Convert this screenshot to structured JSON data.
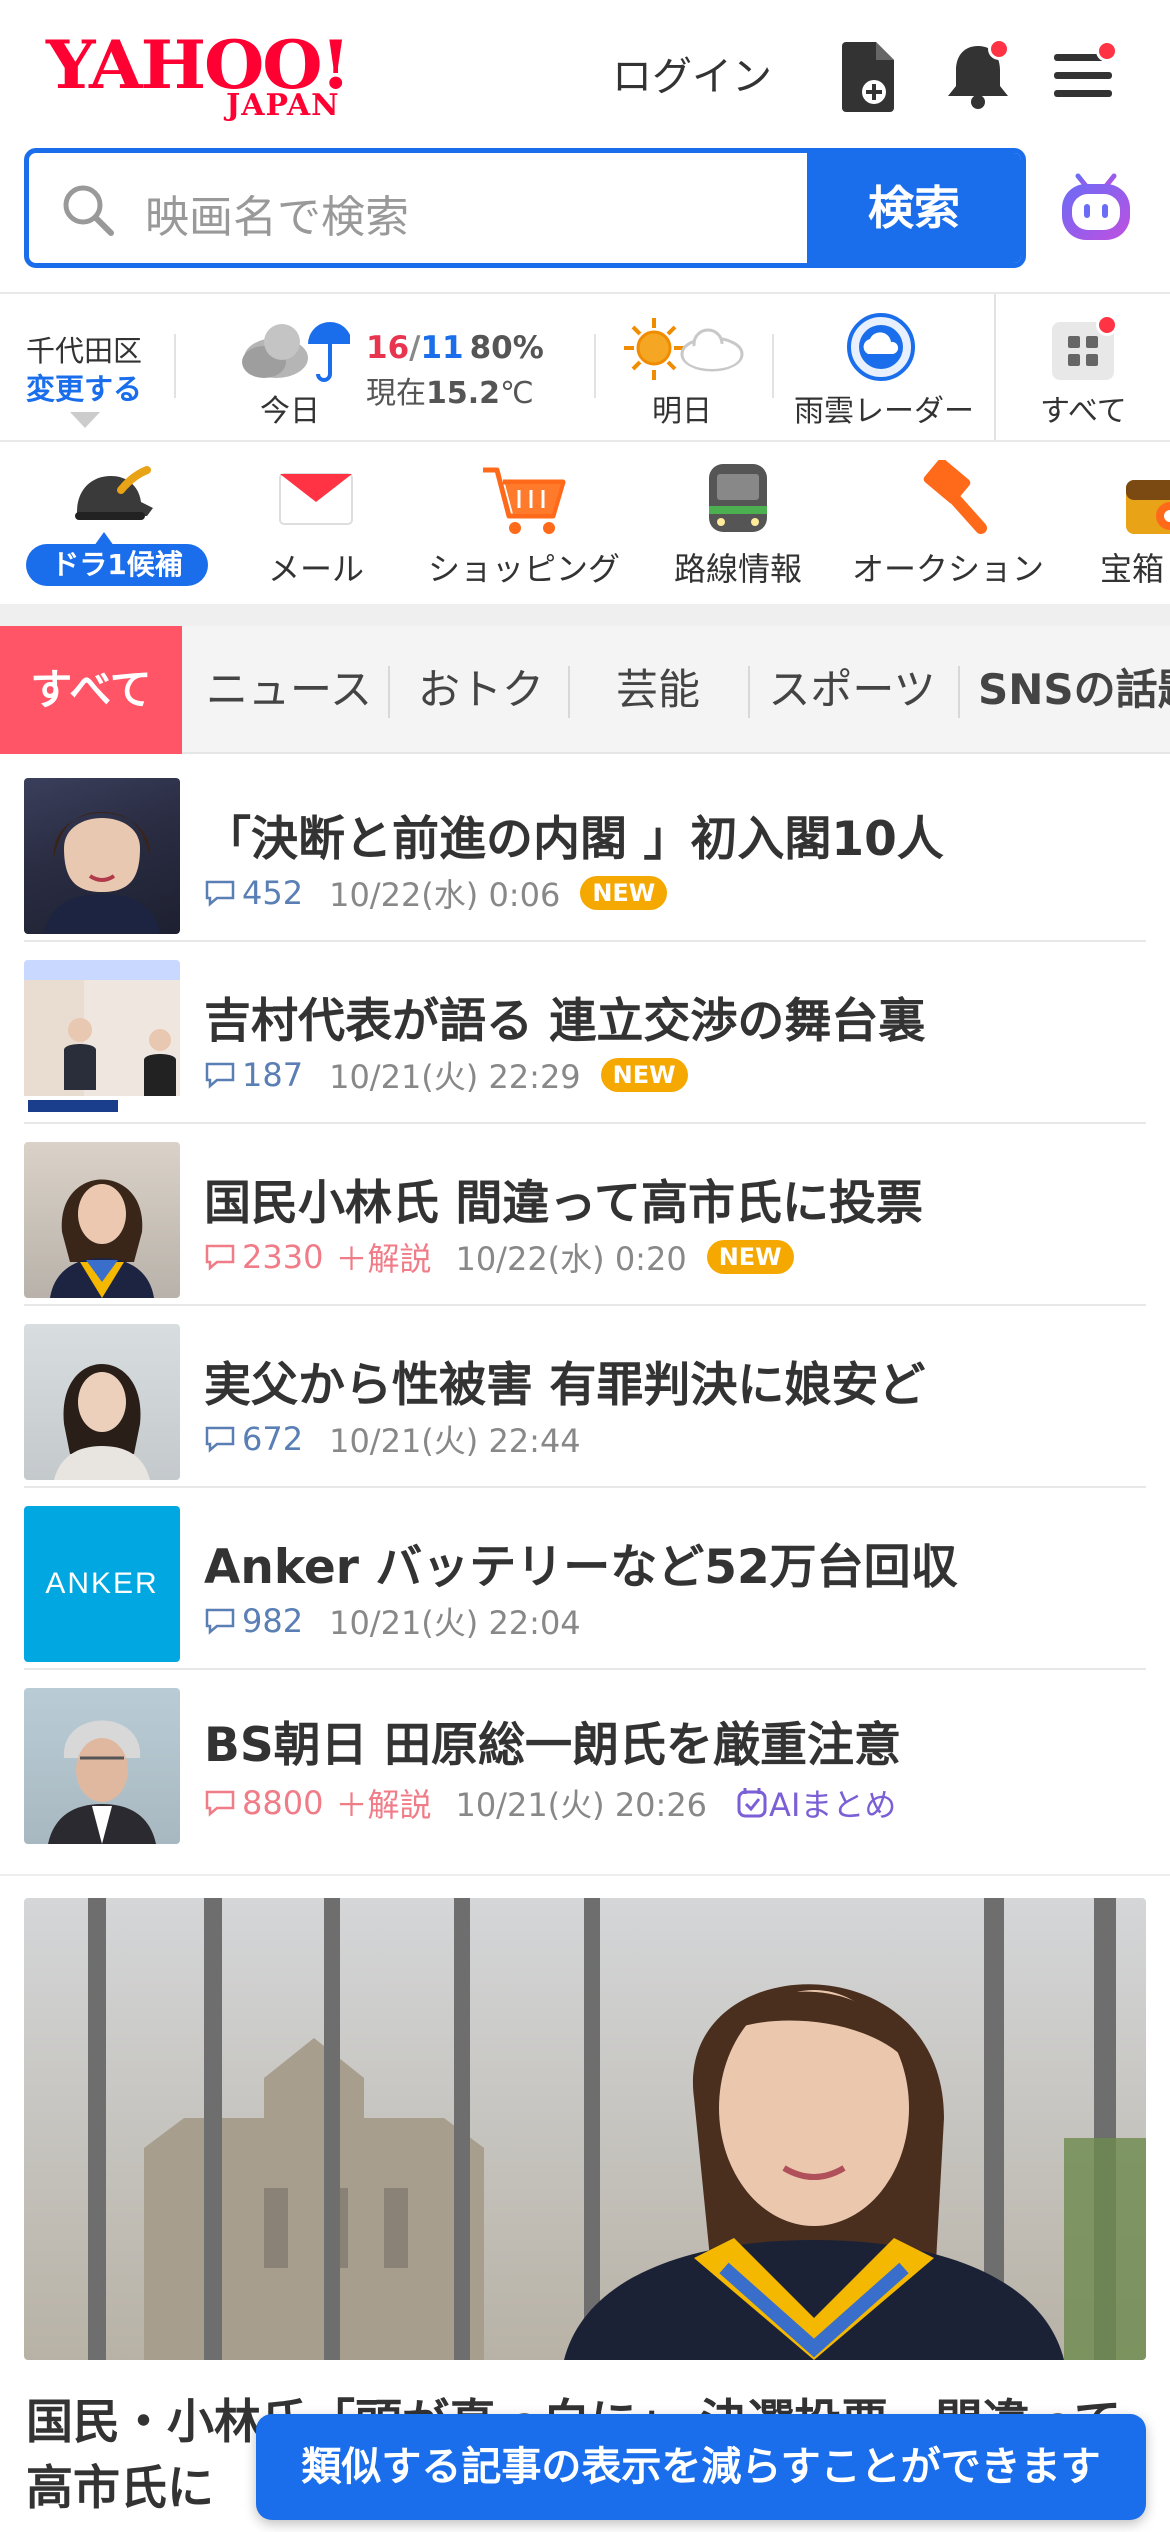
{
  "header": {
    "logo_text": "YAHOO!",
    "logo_sub": "JAPAN",
    "login_label": "ログイン",
    "icons": [
      "add-document-icon",
      "bell-icon",
      "menu-icon"
    ]
  },
  "search": {
    "placeholder": "映画名で検索",
    "button_label": "検索"
  },
  "weather": {
    "location": "千代田区",
    "change_label": "変更する",
    "today_label": "今日",
    "high": "16",
    "slash": "/",
    "low": "11",
    "rain_chance": "80%",
    "current_prefix": "現在",
    "current_temp": "15.2",
    "current_unit": "℃",
    "tomorrow_label": "明日",
    "radar_label": "雨雲レーダー",
    "all_label": "すべて",
    "colors": {
      "high": "#e8344e",
      "low": "#1a6eeb"
    }
  },
  "services": [
    {
      "label": "ドラ1候補",
      "icon": "baseball-helmet-icon"
    },
    {
      "label": "メール",
      "icon": "mail-icon"
    },
    {
      "label": "ショッピング",
      "icon": "shopping-cart-icon"
    },
    {
      "label": "路線情報",
      "icon": "train-icon"
    },
    {
      "label": "オークション",
      "icon": "auction-hammer-icon"
    },
    {
      "label": "宝箱",
      "icon": "treasure-chest-icon"
    }
  ],
  "tabs": [
    "すべて",
    "ニュース",
    "おトク",
    "芸能",
    "スポーツ",
    "SNSの話題"
  ],
  "news": [
    {
      "title": "「決断と前進の内閣 」初入閣10人",
      "comments": "452",
      "date": "10/22(水) 0:06",
      "badge": "NEW"
    },
    {
      "title": "吉村代表が語る 連立交渉の舞台裏",
      "comments": "187",
      "date": "10/21(火) 22:29",
      "badge": "NEW"
    },
    {
      "title": "国民小林氏 間違って高市氏に投票",
      "comments": "2330",
      "extra": "＋解説",
      "date": "10/22(水) 0:20",
      "badge": "NEW"
    },
    {
      "title": "実父から性被害 有罪判決に娘安ど",
      "comments": "672",
      "date": "10/21(火) 22:44"
    },
    {
      "title": "Anker バッテリーなど52万台回収",
      "comments": "982",
      "date": "10/21(火) 22:04",
      "thumb_text": "ANKER"
    },
    {
      "title": "BS朝日 田原総一朗氏を厳重注意",
      "comments": "8800",
      "extra": "＋解説",
      "date": "10/21(火) 20:26",
      "ai_label": "AIまとめ"
    }
  ],
  "feature": {
    "title": "国民・小林氏「頭が真っ白に」 決選投票、間違って高市氏に"
  },
  "toast": "類似する記事の表示を減らすことができます"
}
